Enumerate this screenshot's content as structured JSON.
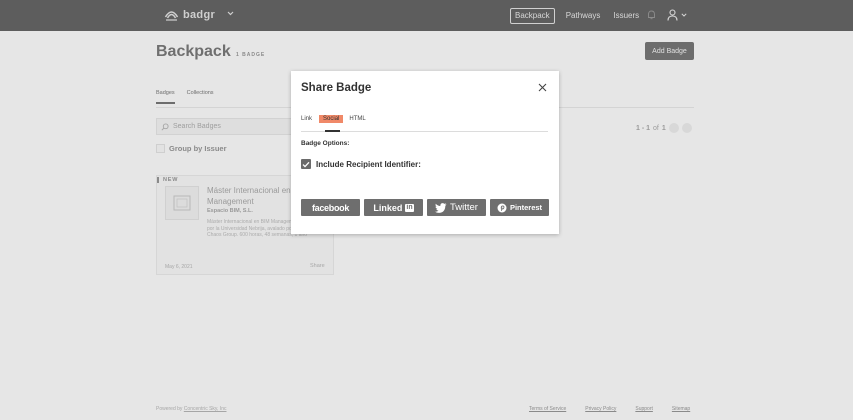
{
  "nav": {
    "logo_text": "badgr",
    "items": [
      {
        "label": "Backpack",
        "active": true
      },
      {
        "label": "Pathways",
        "active": false
      },
      {
        "label": "Issuers",
        "active": false
      }
    ],
    "icons": [
      "badgr-logo-icon",
      "chevron-down-icon",
      "bell-icon",
      "user-icon",
      "chevron-down-icon"
    ]
  },
  "page": {
    "title": "Backpack",
    "badge_count": "1 BADGE",
    "add_badge_label": "Add Badge",
    "tabs": [
      {
        "label": "Badges",
        "active": true
      },
      {
        "label": "Collections",
        "active": false
      }
    ],
    "search_placeholder": "Search Badges",
    "group_by_label": "Group by Issuer",
    "pagination": {
      "range": "1 - 1",
      "of": "of",
      "total": "1"
    }
  },
  "card": {
    "new_label": "NEW",
    "title": "Máster Internacional en BIM Management",
    "issuer": "Espacio BIM, S.L.",
    "description": "Máster Internacional en BIM Management. Avalado por la Universidad Nebrija, avalado por Autodesk y Chaos Group. 600 horas, 48 semanas, 1 año",
    "date": "May 6, 2021",
    "share_label": "Share"
  },
  "footer": {
    "powered_by": "Powered by",
    "powered_link": "Concentric Sky, Inc",
    "links": [
      "Terms of Service",
      "Privacy Policy",
      "Support",
      "Sitemap"
    ]
  },
  "modal": {
    "title": "Share Badge",
    "tabs": [
      {
        "label": "Link",
        "selected": false
      },
      {
        "label": "Social",
        "selected": true
      },
      {
        "label": "HTML",
        "selected": false
      }
    ],
    "options_label": "Badge Options:",
    "include_identifier_label": "Include Recipient Identifier:",
    "include_identifier_checked": true,
    "share_buttons": {
      "facebook": "facebook",
      "linkedin": "Linked",
      "linkedin_box": "in",
      "twitter": "Twitter",
      "pinterest": "Pinterest"
    },
    "tab_highlight_color": "#f08968"
  }
}
